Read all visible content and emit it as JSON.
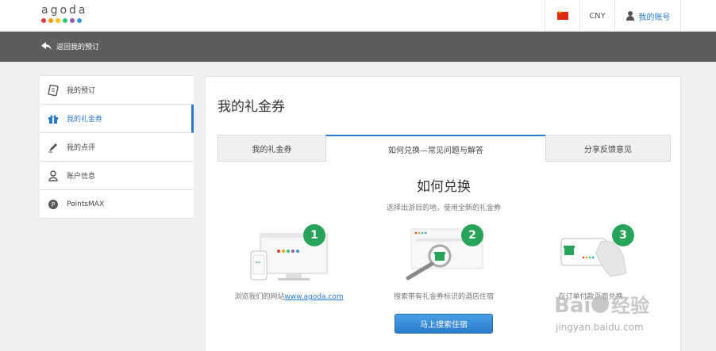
{
  "header": {
    "logo_text": "agoda",
    "logo_colors": [
      "#e23c3c",
      "#f39c12",
      "#f1c40f",
      "#2ecc71",
      "#9b59b6",
      "#3498db"
    ],
    "currency": "CNY",
    "account_label": "我的账号"
  },
  "subheader": {
    "back_label": "返回我的预订"
  },
  "sidebar": {
    "items": [
      {
        "label": "我的预订",
        "icon": "booking-icon",
        "active": false
      },
      {
        "label": "我的礼金券",
        "icon": "gift-icon",
        "active": true
      },
      {
        "label": "我的点评",
        "icon": "pen-icon",
        "active": false
      },
      {
        "label": "账户信息",
        "icon": "person-icon",
        "active": false
      },
      {
        "label": "PointsMAX",
        "icon": "points-icon",
        "active": false
      }
    ]
  },
  "main": {
    "title": "我的礼金券",
    "tabs": [
      {
        "label": "我的礼金券",
        "active": false
      },
      {
        "label": "如何兑换—常见问题与解答",
        "active": true
      },
      {
        "label": "分享反馈意见",
        "active": false
      }
    ],
    "section_title": "如何兑换",
    "section_subtitle": "选择出游目的地，使用全新的礼金券",
    "steps": [
      {
        "number": "1",
        "caption": "浏览我们的网站",
        "link": "www.agoda.com",
        "illustration": "devices-icon"
      },
      {
        "number": "2",
        "caption": "搜索带有礼金券标识的酒店住宿",
        "illustration": "magnifier-gift-icon"
      },
      {
        "number": "3",
        "caption": "在订单付款页面兑换",
        "illustration": "hand-card-icon"
      }
    ],
    "cta_label": "马上搜索住宿"
  },
  "watermark": {
    "brand": "Bai",
    "suffix": "经验",
    "url": "jingyan.baidu.com"
  },
  "colors": {
    "accent": "#2b7bcc",
    "step_badge": "#26a55a",
    "dark_bar": "#5d5d5d"
  }
}
